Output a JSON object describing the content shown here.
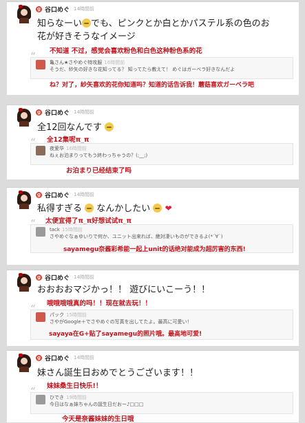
{
  "posts": [
    {
      "author": "谷口めぐ",
      "time": "14時間前",
      "text_a": "知らなーい",
      "text_b": "でも、ピンクとか白とかパステル系の色のお",
      "text_line2": "花が好きそうなイメージ",
      "translation": "不知道 不过，感觉会喜欢粉色和白色这种粉色系的花",
      "reply": {
        "name": "亀さん★さやめぐ特攻服",
        "time": "16時間前",
        "text": "そうだ、紗矢の好きな花知ってる？ 知ってたら教えて！ めぐはガーベラ好きなんだよ",
        "text2": "ね？对了，紗矢喜欢的花你知道吗？知道的话告诉我！蘑菇喜欢ガーベラ吧"
      }
    },
    {
      "author": "谷口めぐ",
      "time": "14時間前",
      "text": "全12回なんです",
      "translation": "全12集呢π_π",
      "reply": {
        "name": "夜爱华",
        "time": "16時間前",
        "text": "ねぇお泊まりってもう終わっちゃうの？(;__;)",
        "translation": "お泊まり已经结束了吗"
      }
    },
    {
      "author": "谷口めぐ",
      "time": "14時間前",
      "text_a": "私得すぎる",
      "text_b": "なんかしたい",
      "translation": "太便宜得了π_π好想试试π_π",
      "reply": {
        "name": "tack",
        "time": "15時間前",
        "text": "さやめぐなぁゆいりで何か、ユニット出来れば、絶対凄いものができるよ(*´∀`)",
        "translation": "sayamegu奈酱彩希能一起上unit的话绝对能成为超厉害的东西!"
      }
    },
    {
      "author": "谷口めぐ",
      "time": "14時間前",
      "text": "おおおおマジかっ！！ 遊びにいこーう！！",
      "translation": "哦哦哦哦真的吗！！现在就去玩！！",
      "reply": {
        "name": "パック",
        "time": "15時間前",
        "text": "さやがGoogle＋でさやめぐの写真を出してたよ。最高に可愛い！",
        "translation": "sayaya在G+贴了sayamegu的照片哦。最高地可爱!"
      }
    },
    {
      "author": "谷口めぐ",
      "time": "14時間前",
      "text": "妹さん誕生日おめでとうございます！！",
      "translation": "妹妹桑生日快乐!！",
      "reply": {
        "name": "ひでき",
        "time": "19時間前",
        "text": "今日はなぁ妹ちゃんの誕生日だおー♪□□□",
        "translation": "今天是奈酱妹妹的生日哦"
      }
    }
  ]
}
